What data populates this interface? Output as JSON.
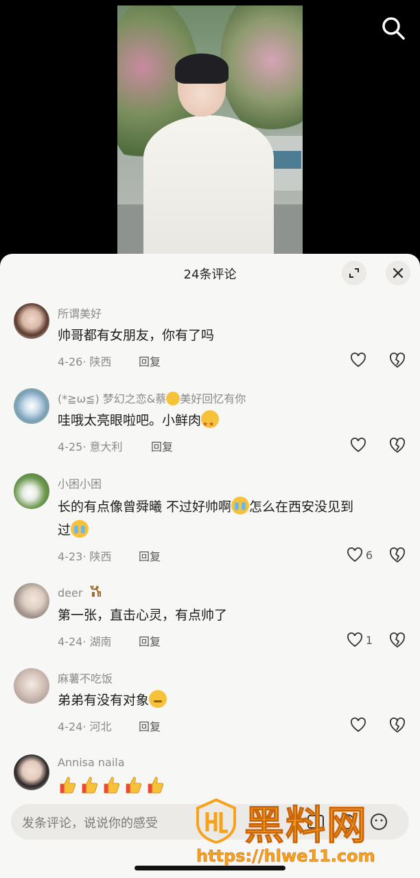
{
  "header": {
    "comment_count_title": "24条评论"
  },
  "comments": [
    {
      "username": "所谓美好",
      "text": "帅哥都有女朋友，你有了吗",
      "date_location": "4-26· 陕西",
      "reply_label": "回复",
      "like_count": ""
    },
    {
      "username": "(*≧ω≦) 梦幻之恋&蔡",
      "username_tail": "美好回忆有你",
      "text": "哇哦太亮眼啦吧。小鲜肉",
      "date_location": "4-25· 意大利",
      "reply_label": "回复",
      "like_count": ""
    },
    {
      "username": "小困小困",
      "text_part1": "长的有点像曾舜曦  不过好帅啊",
      "text_part2": "怎么在西安没见到",
      "text_part3": "过",
      "date_location": "4-23· 陕西",
      "reply_label": "回复",
      "like_count": "6"
    },
    {
      "username": "deer",
      "text": "第一张，直击心灵，有点帅了",
      "date_location": "4-24· 湖南",
      "reply_label": "回复",
      "like_count": "1"
    },
    {
      "username": "麻薯不吃饭",
      "text": "弟弟有没有对象",
      "date_location": "4-24· 河北",
      "reply_label": "回复",
      "like_count": ""
    },
    {
      "username": "Annisa naila",
      "emoji_summary": "thumbs-up x5"
    }
  ],
  "input": {
    "placeholder": "发条评论，说说你的感受"
  },
  "watermark": {
    "title": "黑料网",
    "url": "https://hlwe11.com"
  },
  "colors": {
    "sheet_bg": "#f7f7f5",
    "username": "#8a8a8a",
    "watermark": "#f7a21b"
  }
}
